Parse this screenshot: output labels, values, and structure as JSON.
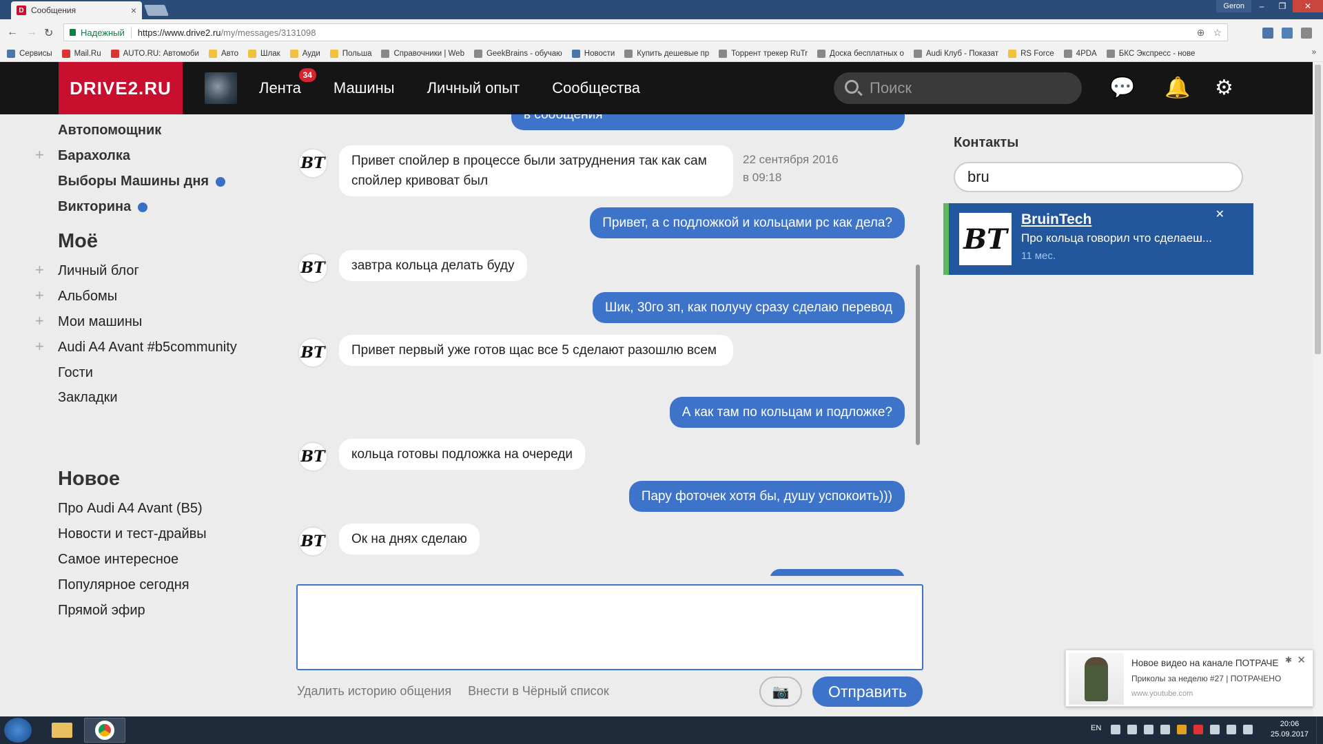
{
  "browser": {
    "tab_title": "Сообщения",
    "tab_favicon": "D",
    "user_badge": "Geron",
    "secure_label": "Надежный",
    "url_host": "https://www.drive2.ru",
    "url_path": "/my/messages/3131098",
    "bookmarks": [
      {
        "label": "Сервисы",
        "icon": "apps-icon"
      },
      {
        "label": "Mail.Ru",
        "icon": "mailru-icon"
      },
      {
        "label": "AUTO.RU: Автомоби",
        "icon": "autoru-icon"
      },
      {
        "label": "Авто",
        "icon": "folder-icon"
      },
      {
        "label": "Шлак",
        "icon": "folder-icon"
      },
      {
        "label": "Ауди",
        "icon": "folder-icon"
      },
      {
        "label": "Польша",
        "icon": "folder-icon"
      },
      {
        "label": "Справочники | Web",
        "icon": "page-icon"
      },
      {
        "label": "GeekBrains - обучаю",
        "icon": "page-icon"
      },
      {
        "label": "Новости",
        "icon": "vk-icon"
      },
      {
        "label": "Купить дешевые пр",
        "icon": "page-icon"
      },
      {
        "label": "Торрент трекер RuTr",
        "icon": "page-icon"
      },
      {
        "label": "Доска бесплатных о",
        "icon": "page-icon"
      },
      {
        "label": "Audi Клуб - Показат",
        "icon": "page-icon"
      },
      {
        "label": "RS Force",
        "icon": "folder-icon"
      },
      {
        "label": "4PDA",
        "icon": "page-icon"
      },
      {
        "label": "БКС Экспресс - нове",
        "icon": "page-icon"
      }
    ],
    "bookmarks_more": "»"
  },
  "site": {
    "logo": "DRIVE2.RU",
    "nav": [
      {
        "label": "Лента",
        "badge": "34"
      },
      {
        "label": "Машины"
      },
      {
        "label": "Личный опыт"
      },
      {
        "label": "Сообщества"
      }
    ],
    "search_placeholder": "Поиск"
  },
  "sidebar": {
    "top_items": [
      {
        "label": "Автопомощник",
        "plus": false,
        "dot": false
      },
      {
        "label": "Барахолка",
        "plus": true,
        "dot": false
      },
      {
        "label": "Выборы Машины дня",
        "plus": false,
        "dot": true
      },
      {
        "label": "Викторина",
        "plus": false,
        "dot": true
      }
    ],
    "my_heading": "Моё",
    "my_items": [
      {
        "label": "Личный блог",
        "plus": true
      },
      {
        "label": "Альбомы",
        "plus": true
      },
      {
        "label": "Мои машины",
        "plus": true
      },
      {
        "label": "Audi A4 Avant #b5community",
        "plus": true
      },
      {
        "label": "Гости",
        "plus": false
      },
      {
        "label": "Закладки",
        "plus": false
      }
    ],
    "new_heading": "Новое",
    "new_items": [
      {
        "label": "Про Audi A4 Avant (B5)"
      },
      {
        "label": "Новости и тест-драйвы"
      },
      {
        "label": "Самое интересное"
      },
      {
        "label": "Популярное сегодня"
      },
      {
        "label": "Прямой эфир"
      }
    ]
  },
  "chat": {
    "avatar_text": "BT",
    "messages": [
      {
        "dir": "out",
        "text": "в сообщения"
      },
      {
        "dir": "in",
        "text": "Привет спойлер в процессе были затруднения так как сам спойлер кривоват был"
      },
      {
        "dir": "out",
        "text": "Привет, а с подложкой и кольцами рс как дела?"
      },
      {
        "dir": "in",
        "text": "завтра кольца делать буду"
      },
      {
        "dir": "out",
        "text": "Шик, 30го зп, как получу сразу сделаю перевод"
      },
      {
        "dir": "in",
        "text": "Привет первый уже готов щас все 5 сделают разошлю всем"
      },
      {
        "dir": "out",
        "text": "А как там по кольцам и подложке?"
      },
      {
        "dir": "in",
        "text": "кольца готовы подложка на очереди"
      },
      {
        "dir": "out",
        "text": "Пару фоточек хотя бы, душу успокоить)))"
      },
      {
        "dir": "in",
        "text": "Ок на днях сделаю"
      }
    ],
    "date_line1": "22 сентября 2016",
    "date_line2": "в 09:18",
    "composer_value": "",
    "delete_history": "Удалить историю общения",
    "blacklist": "Внести в Чёрный список",
    "send_label": "Отправить"
  },
  "contacts": {
    "title": "Контакты",
    "search_value": "bru",
    "items": [
      {
        "name": "BruinTech",
        "preview": "Про кольца говорил что сделаеш...",
        "time": "11 мес.",
        "avatar_text": "BT"
      }
    ]
  },
  "notification": {
    "title": "Новое видео на канале ПОТРАЧЕ",
    "text": "Приколы за неделю #27 | ПОТРАЧЕНО",
    "url": "www.youtube.com"
  },
  "taskbar": {
    "lang": "EN",
    "time": "20:06",
    "date": "25.09.2017"
  },
  "colors": {
    "brand_red": "#c8102e",
    "header_bg": "#151515",
    "outgoing_bubble": "#3d73c8",
    "contact_active": "#23579d",
    "unread_dot": "#3a6fc8"
  }
}
